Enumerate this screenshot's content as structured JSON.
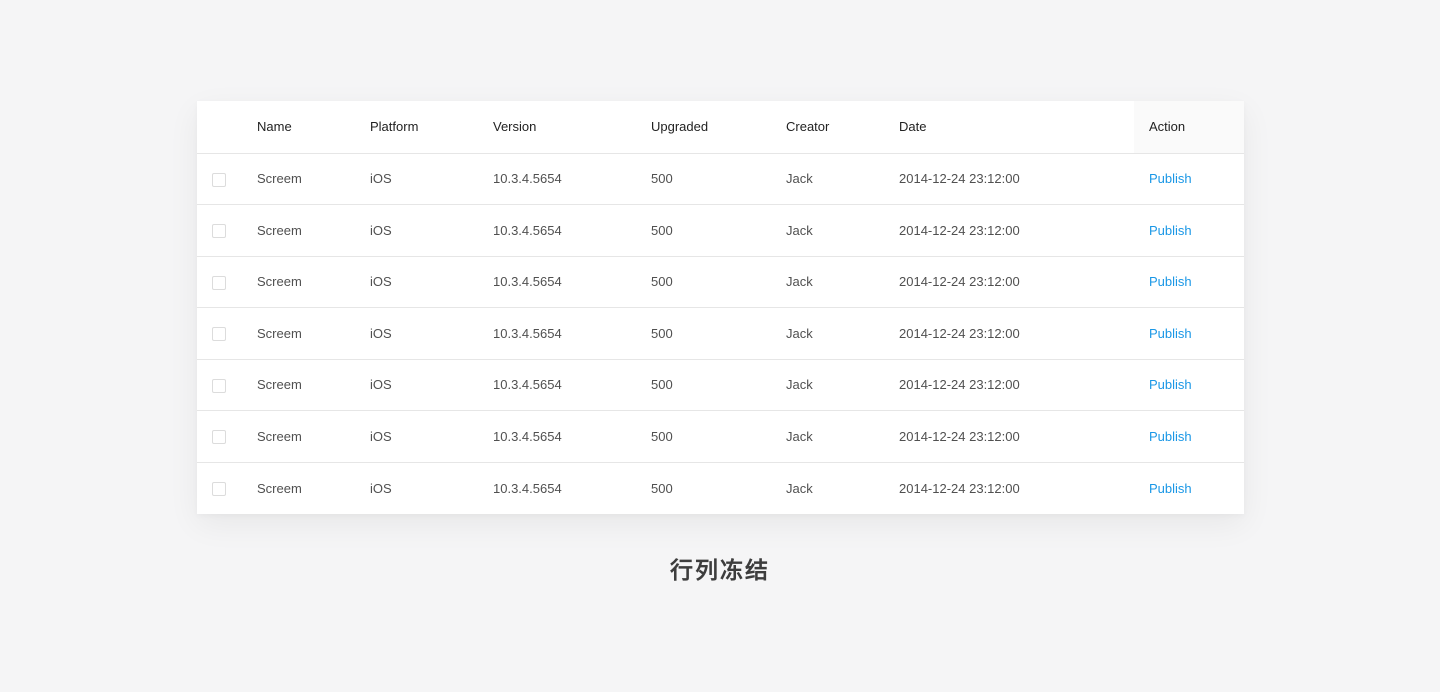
{
  "table": {
    "headers": {
      "name": "Name",
      "platform": "Platform",
      "version": "Version",
      "upgraded": "Upgraded",
      "creator": "Creator",
      "date": "Date",
      "action": "Action"
    },
    "rows": [
      {
        "name": "Screem",
        "platform": "iOS",
        "version": "10.3.4.5654",
        "upgraded": "500",
        "creator": "Jack",
        "date": "2014-12-24 23:12:00",
        "action": "Publish"
      },
      {
        "name": "Screem",
        "platform": "iOS",
        "version": "10.3.4.5654",
        "upgraded": "500",
        "creator": "Jack",
        "date": "2014-12-24 23:12:00",
        "action": "Publish"
      },
      {
        "name": "Screem",
        "platform": "iOS",
        "version": "10.3.4.5654",
        "upgraded": "500",
        "creator": "Jack",
        "date": "2014-12-24 23:12:00",
        "action": "Publish"
      },
      {
        "name": "Screem",
        "platform": "iOS",
        "version": "10.3.4.5654",
        "upgraded": "500",
        "creator": "Jack",
        "date": "2014-12-24 23:12:00",
        "action": "Publish"
      },
      {
        "name": "Screem",
        "platform": "iOS",
        "version": "10.3.4.5654",
        "upgraded": "500",
        "creator": "Jack",
        "date": "2014-12-24 23:12:00",
        "action": "Publish"
      },
      {
        "name": "Screem",
        "platform": "iOS",
        "version": "10.3.4.5654",
        "upgraded": "500",
        "creator": "Jack",
        "date": "2014-12-24 23:12:00",
        "action": "Publish"
      },
      {
        "name": "Screem",
        "platform": "iOS",
        "version": "10.3.4.5654",
        "upgraded": "500",
        "creator": "Jack",
        "date": "2014-12-24 23:12:00",
        "action": "Publish"
      }
    ]
  },
  "caption": "行列冻结",
  "colors": {
    "link": "#1a97e6",
    "background": "#f5f5f6",
    "border": "#e6e6e6"
  }
}
